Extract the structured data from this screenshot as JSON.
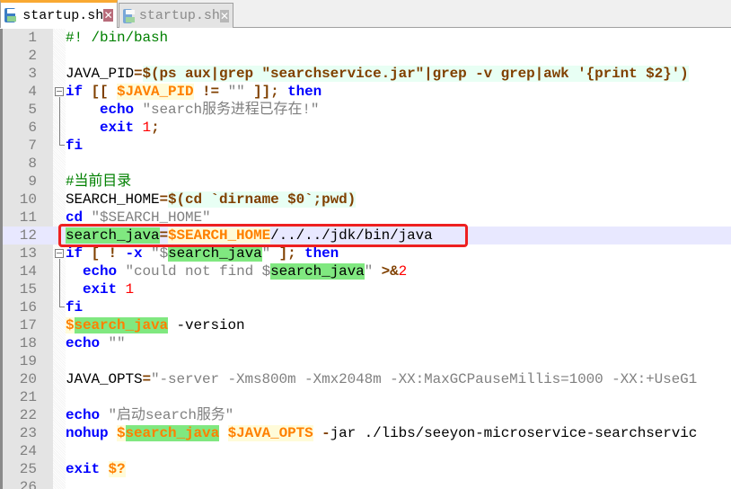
{
  "tabs": [
    {
      "label": "startup.sh",
      "active": true
    },
    {
      "label": "startup.sh",
      "active": false
    }
  ],
  "colors": {
    "keyword": "#0000ff",
    "variable": "#ff8000",
    "string": "#808080",
    "number": "#ff0000",
    "operator": "#804000",
    "comment": "#008000",
    "smart_highlight": "#80e880",
    "current_line": "#e8e8ff",
    "annotation_box": "#ee2020"
  },
  "current_line": 12,
  "lines": [
    {
      "n": "1",
      "t": [
        [
          "cm",
          "#! /bin/bash"
        ]
      ]
    },
    {
      "n": "2",
      "t": []
    },
    {
      "n": "3",
      "t": [
        [
          "plain",
          "JAVA_PID"
        ],
        [
          "op",
          "="
        ],
        [
          "sub",
          "$(ps aux|grep \"searchservice.jar\"|grep -v grep|awk '{print $2}')"
        ]
      ]
    },
    {
      "n": "4",
      "t": [
        [
          "kw",
          "if"
        ],
        [
          "op",
          " [[ "
        ],
        [
          "var",
          "$JAVA_PID"
        ],
        [
          "op",
          " != "
        ],
        [
          "str",
          "\"\""
        ],
        [
          "op",
          " ]]; "
        ],
        [
          "kw",
          "then"
        ]
      ]
    },
    {
      "n": "5",
      "t": [
        [
          "plain",
          "    "
        ],
        [
          "kw",
          "echo"
        ],
        [
          "plain",
          " "
        ],
        [
          "str",
          "\"search服务进程已存在!\""
        ]
      ]
    },
    {
      "n": "6",
      "t": [
        [
          "plain",
          "    "
        ],
        [
          "kw",
          "exit"
        ],
        [
          "plain",
          " "
        ],
        [
          "num",
          "1"
        ],
        [
          "op",
          ";"
        ]
      ]
    },
    {
      "n": "7",
      "t": [
        [
          "kw",
          "fi"
        ]
      ]
    },
    {
      "n": "8",
      "t": []
    },
    {
      "n": "9",
      "t": [
        [
          "cm",
          "#当前目录"
        ]
      ]
    },
    {
      "n": "10",
      "t": [
        [
          "plain",
          "SEARCH_HOME"
        ],
        [
          "op",
          "="
        ],
        [
          "sub",
          "$(cd `dirname $0`;pwd)"
        ]
      ]
    },
    {
      "n": "11",
      "t": [
        [
          "kw",
          "cd"
        ],
        [
          "plain",
          " "
        ],
        [
          "str",
          "\"$SEARCH_HOME\""
        ]
      ]
    },
    {
      "n": "12",
      "t": [
        [
          "hl",
          "search_java"
        ],
        [
          "op",
          "="
        ],
        [
          "var",
          "$SEARCH_HOME"
        ],
        [
          "plain",
          "/../../jdk/bin/java"
        ]
      ]
    },
    {
      "n": "13",
      "t": [
        [
          "kw",
          "if"
        ],
        [
          "op",
          " [ ! "
        ],
        [
          "kw",
          "-x"
        ],
        [
          "plain",
          " "
        ],
        [
          "str",
          "\"$"
        ],
        [
          "hl",
          "search_java"
        ],
        [
          "str",
          "\""
        ],
        [
          "op",
          " ]; "
        ],
        [
          "kw",
          "then"
        ]
      ]
    },
    {
      "n": "14",
      "t": [
        [
          "plain",
          "  "
        ],
        [
          "kw",
          "echo"
        ],
        [
          "plain",
          " "
        ],
        [
          "str",
          "\"could not find $"
        ],
        [
          "hl",
          "search_java"
        ],
        [
          "str",
          "\""
        ],
        [
          "plain",
          " "
        ],
        [
          "op",
          ">&"
        ],
        [
          "num",
          "2"
        ]
      ]
    },
    {
      "n": "15",
      "t": [
        [
          "plain",
          "  "
        ],
        [
          "kw",
          "exit"
        ],
        [
          "plain",
          " "
        ],
        [
          "num",
          "1"
        ]
      ]
    },
    {
      "n": "16",
      "t": [
        [
          "kw",
          "fi"
        ]
      ]
    },
    {
      "n": "17",
      "t": [
        [
          "var",
          "$"
        ],
        [
          "hlv",
          "search_java"
        ],
        [
          "plain",
          " -version"
        ]
      ]
    },
    {
      "n": "18",
      "t": [
        [
          "kw",
          "echo"
        ],
        [
          "plain",
          " "
        ],
        [
          "str",
          "\"\""
        ]
      ]
    },
    {
      "n": "19",
      "t": []
    },
    {
      "n": "20",
      "t": [
        [
          "plain",
          "JAVA_OPTS"
        ],
        [
          "op",
          "="
        ],
        [
          "str",
          "\"-server -Xms800m -Xmx2048m -XX:MaxGCPauseMillis=1000 -XX:+UseG1"
        ]
      ]
    },
    {
      "n": "21",
      "t": []
    },
    {
      "n": "22",
      "t": [
        [
          "kw",
          "echo"
        ],
        [
          "plain",
          " "
        ],
        [
          "str",
          "\"启动search服务\""
        ]
      ]
    },
    {
      "n": "23",
      "t": [
        [
          "kw",
          "nohup"
        ],
        [
          "plain",
          " "
        ],
        [
          "var",
          "$"
        ],
        [
          "hlv",
          "search_java"
        ],
        [
          "plain",
          " "
        ],
        [
          "var",
          "$JAVA_OPTS"
        ],
        [
          "plain",
          " "
        ],
        [
          "op",
          "-"
        ],
        [
          "plain",
          "jar ./libs/seeyon-microservice-searchservic"
        ]
      ]
    },
    {
      "n": "24",
      "t": []
    },
    {
      "n": "25",
      "t": [
        [
          "kw",
          "exit"
        ],
        [
          "plain",
          " "
        ],
        [
          "var",
          "$?"
        ]
      ]
    },
    {
      "n": "26",
      "t": []
    }
  ]
}
